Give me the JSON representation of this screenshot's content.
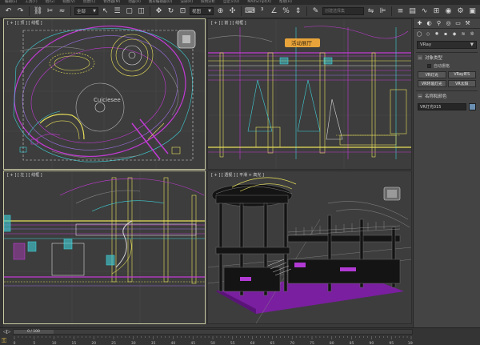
{
  "menubar": {
    "items": [
      "编辑(E)",
      "工具(T)",
      "组(G)",
      "视图(V)",
      "创建(C)",
      "修改器(M)",
      "动画(A)",
      "图形编辑器(D)",
      "渲染(R)",
      "照明分析",
      "自定义(U)",
      "MAXScript(X)",
      "帮助(H)"
    ]
  },
  "toolbar": {
    "filter_label": "全部",
    "view_label": "视图",
    "selection_set_placeholder": "创建选择集"
  },
  "viewports": {
    "top_label": "[ + ] [ 顶 ] [ 线框 ]",
    "front_label": "[ + ] [ 前 ] [ 线框 ]",
    "left_label": "[ + ] [ 左 ] [ 线框 ]",
    "persp_label": "[ + ] [ 透视 ] [ 平滑 + 高光 ]",
    "logo_text": "Cuiciesee",
    "sign_text": "活动展厅"
  },
  "command_panel": {
    "tabs": [
      "create-icon",
      "modify-icon",
      "hierarchy-icon",
      "motion-icon",
      "display-icon",
      "utilities-icon"
    ],
    "type_dropdown": "VRay",
    "object_type_header": "对象类型",
    "autogrid_label": "自动栅格",
    "buttons": [
      "VR灯光",
      "VRayIES",
      "VR环境灯光",
      "VR太阳"
    ],
    "name_color_header": "名称和颜色",
    "name_value": "VR灯光015",
    "name_color": "#6a8fb0"
  },
  "timeline": {
    "frame_label": "0 / 100",
    "ticks": [
      "0",
      "5",
      "10",
      "15",
      "20",
      "25",
      "30",
      "35",
      "40",
      "45",
      "50",
      "55",
      "60",
      "65",
      "70",
      "75",
      "80",
      "85",
      "90",
      "95",
      "100"
    ]
  },
  "colors": {
    "viewport_bg": "#3d3d3d",
    "active_border": "#c9c9a3",
    "magenta": "#c23bd4",
    "cyan": "#3fd0d8",
    "yellow": "#e8e05a",
    "floor_purple": "#7a1fa0"
  }
}
